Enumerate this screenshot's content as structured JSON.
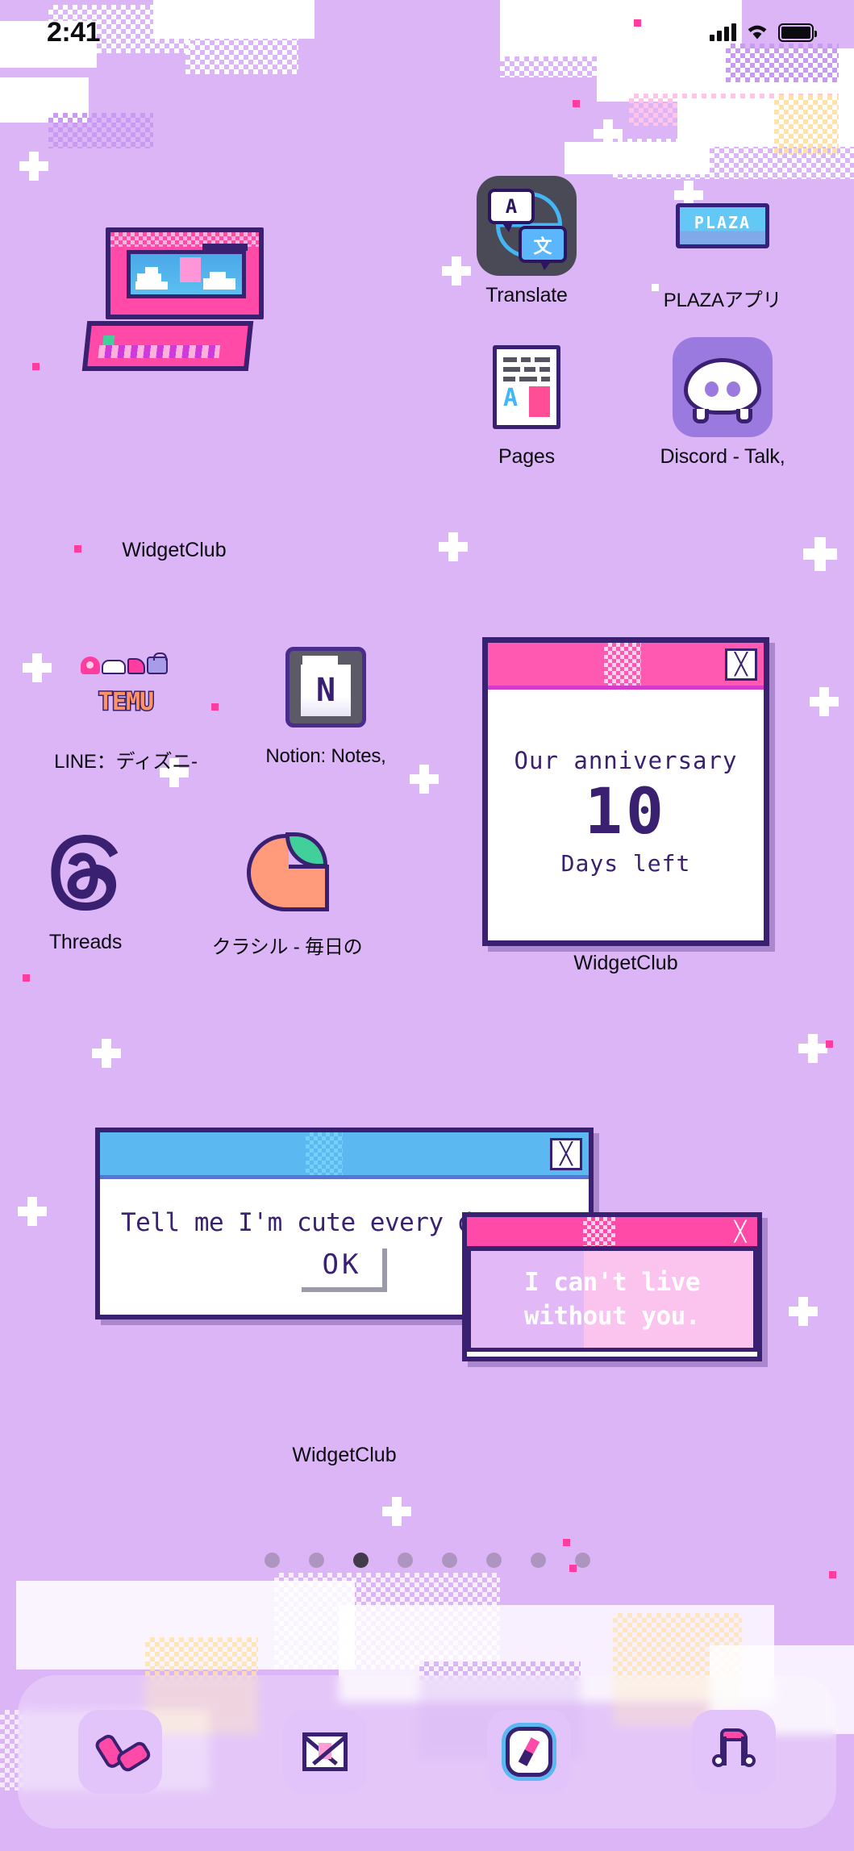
{
  "status_bar": {
    "time": "2:41",
    "signal_icon": "cellular-signal-icon",
    "wifi_icon": "wifi-icon",
    "battery_icon": "battery-icon"
  },
  "apps": [
    {
      "id": "widgetclub-pc",
      "label": "WidgetClub",
      "icon": "retro-computer-icon"
    },
    {
      "id": "translate",
      "label": "Translate",
      "icon": "translate-icon",
      "bubble_a": "A",
      "bubble_b": "文"
    },
    {
      "id": "plaza",
      "label": "PLAZAアプリ",
      "icon": "plaza-banner-icon",
      "banner_text": "PLAZA"
    },
    {
      "id": "pages",
      "label": "Pages",
      "icon": "pages-document-icon"
    },
    {
      "id": "discord",
      "label": "Discord - Talk,",
      "icon": "discord-icon"
    },
    {
      "id": "line-disney",
      "label": "LINE：ディズニ-",
      "icon": "temu-icon",
      "wordmark": "TEMU"
    },
    {
      "id": "notion",
      "label": "Notion: Notes,",
      "icon": "notion-icon",
      "glyph": "N"
    },
    {
      "id": "threads",
      "label": "Threads",
      "icon": "threads-icon",
      "glyph": "@"
    },
    {
      "id": "kurashiru",
      "label": "クラシル - 毎日の",
      "icon": "kurashiru-icon"
    }
  ],
  "widgets": {
    "anniversary": {
      "label": "WidgetClub",
      "title": "Our anniversary",
      "count": "10",
      "subtitle": "Days left",
      "close_icon": "close-x-icon",
      "titlebar_color": "#ff59b2"
    },
    "dialog": {
      "label": "WidgetClub",
      "message": "Tell me I'm cute every day!",
      "ok_label": "OK",
      "close_icon": "close-x-icon",
      "titlebar_color": "#5bb8f0"
    },
    "quote": {
      "line1": "I can't live",
      "line2": "without you.",
      "close_icon": "close-x-icon",
      "titlebar_color": "#ff4aa8"
    }
  },
  "page_dots": {
    "count": 8,
    "active_index": 2
  },
  "dock": [
    {
      "id": "phone",
      "icon": "phone-handset-icon"
    },
    {
      "id": "mail",
      "icon": "mail-envelope-icon"
    },
    {
      "id": "safari",
      "icon": "safari-compass-icon"
    },
    {
      "id": "music",
      "icon": "music-note-icon"
    }
  ],
  "theme": {
    "background": "#dcb5f7",
    "accent_pink": "#ff4aa8",
    "accent_blue": "#5bb8f0",
    "outline": "#3a2070"
  }
}
